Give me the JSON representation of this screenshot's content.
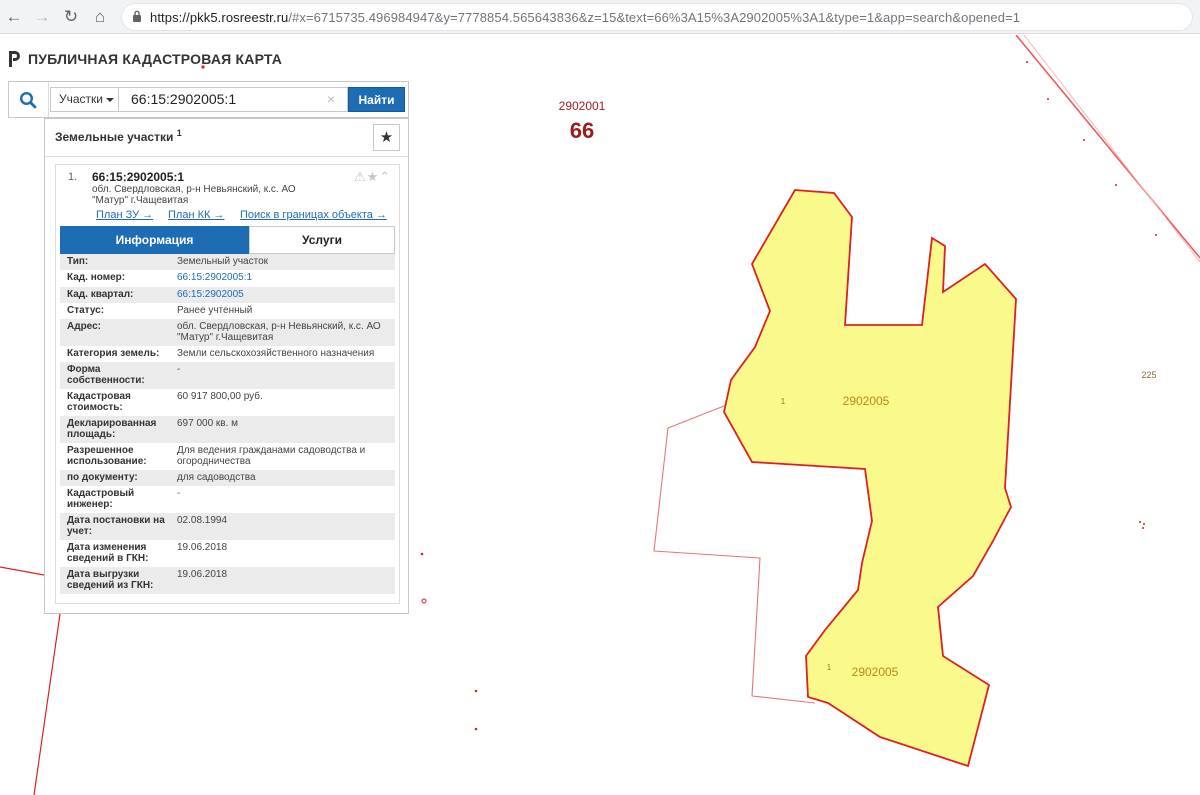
{
  "browser": {
    "url_host": "https://pkk5.rosreestr.ru",
    "url_rest": "/#x=6715735.496984947&y=7778854.565643836&z=15&text=66%3A15%3A2902005%3A1&type=1&app=search&opened=1"
  },
  "header": {
    "title": "ПУБЛИЧНАЯ КАДАСТРОВАЯ КАРТА"
  },
  "search": {
    "type_label": "Участки",
    "query": "66:15:2902005:1",
    "clear_symbol": "×",
    "button_label": "Найти"
  },
  "results": {
    "title": "Земельные участки",
    "count": "1",
    "item": {
      "index": "1.",
      "cadastral_number": "66:15:2902005:1",
      "address": "обл. Свердловская, р-н Невьянский, к.с. АО \"Матур\" г.Чащевитая",
      "icons": "⚠★⌃",
      "links": [
        "План ЗУ →",
        "План КК →",
        "Поиск в границах объекта →"
      ],
      "tabs": [
        "Информация",
        "Услуги"
      ],
      "rows": [
        {
          "label": "Тип:",
          "value": "Земельный участок"
        },
        {
          "label": "Кад. номер:",
          "value": "66:15:2902005:1"
        },
        {
          "label": "Кад. квартал:",
          "value": "66:15:2902005"
        },
        {
          "label": "Статус:",
          "value": "Ранее учтенный"
        },
        {
          "label": "Адрес:",
          "value": "обл. Свердловская, р-н Невьянский, к.с. АО \"Матур\" г.Чащевитая"
        },
        {
          "label": "Категория земель:",
          "value": "Земли сельскохозяйственного назначения"
        },
        {
          "label": "Форма собственности:",
          "value": "-"
        },
        {
          "label": "Кадастровая стоимость:",
          "value": "60 917 800,00 руб."
        },
        {
          "label": "Декларированная площадь:",
          "value": "697 000 кв. м"
        },
        {
          "label": "Разрешенное использование:",
          "value": "Для ведения гражданами садоводства и огородничества"
        },
        {
          "label": "по документу:",
          "value": "для садоводства"
        },
        {
          "label": "Кадастровый инженер:",
          "value": "-"
        },
        {
          "label": "Дата постановки на учет:",
          "value": "02.08.1994"
        },
        {
          "label": "Дата изменения сведений в ГКН:",
          "value": "19.06.2018"
        },
        {
          "label": "Дата выгрузки сведений из ГКН:",
          "value": "19.06.2018"
        }
      ]
    }
  },
  "map": {
    "district_code": "66",
    "quarter_number": "2902001",
    "parcel_labels": [
      "2902005",
      "2902005"
    ],
    "parcel_sub_labels": [
      "1",
      "1"
    ],
    "neighbor_label": "225",
    "parcel_fill": "#fafa8c",
    "boundary_color": "#e02020",
    "label_color": "#b58a18",
    "district_color": "#9b1c1c"
  }
}
